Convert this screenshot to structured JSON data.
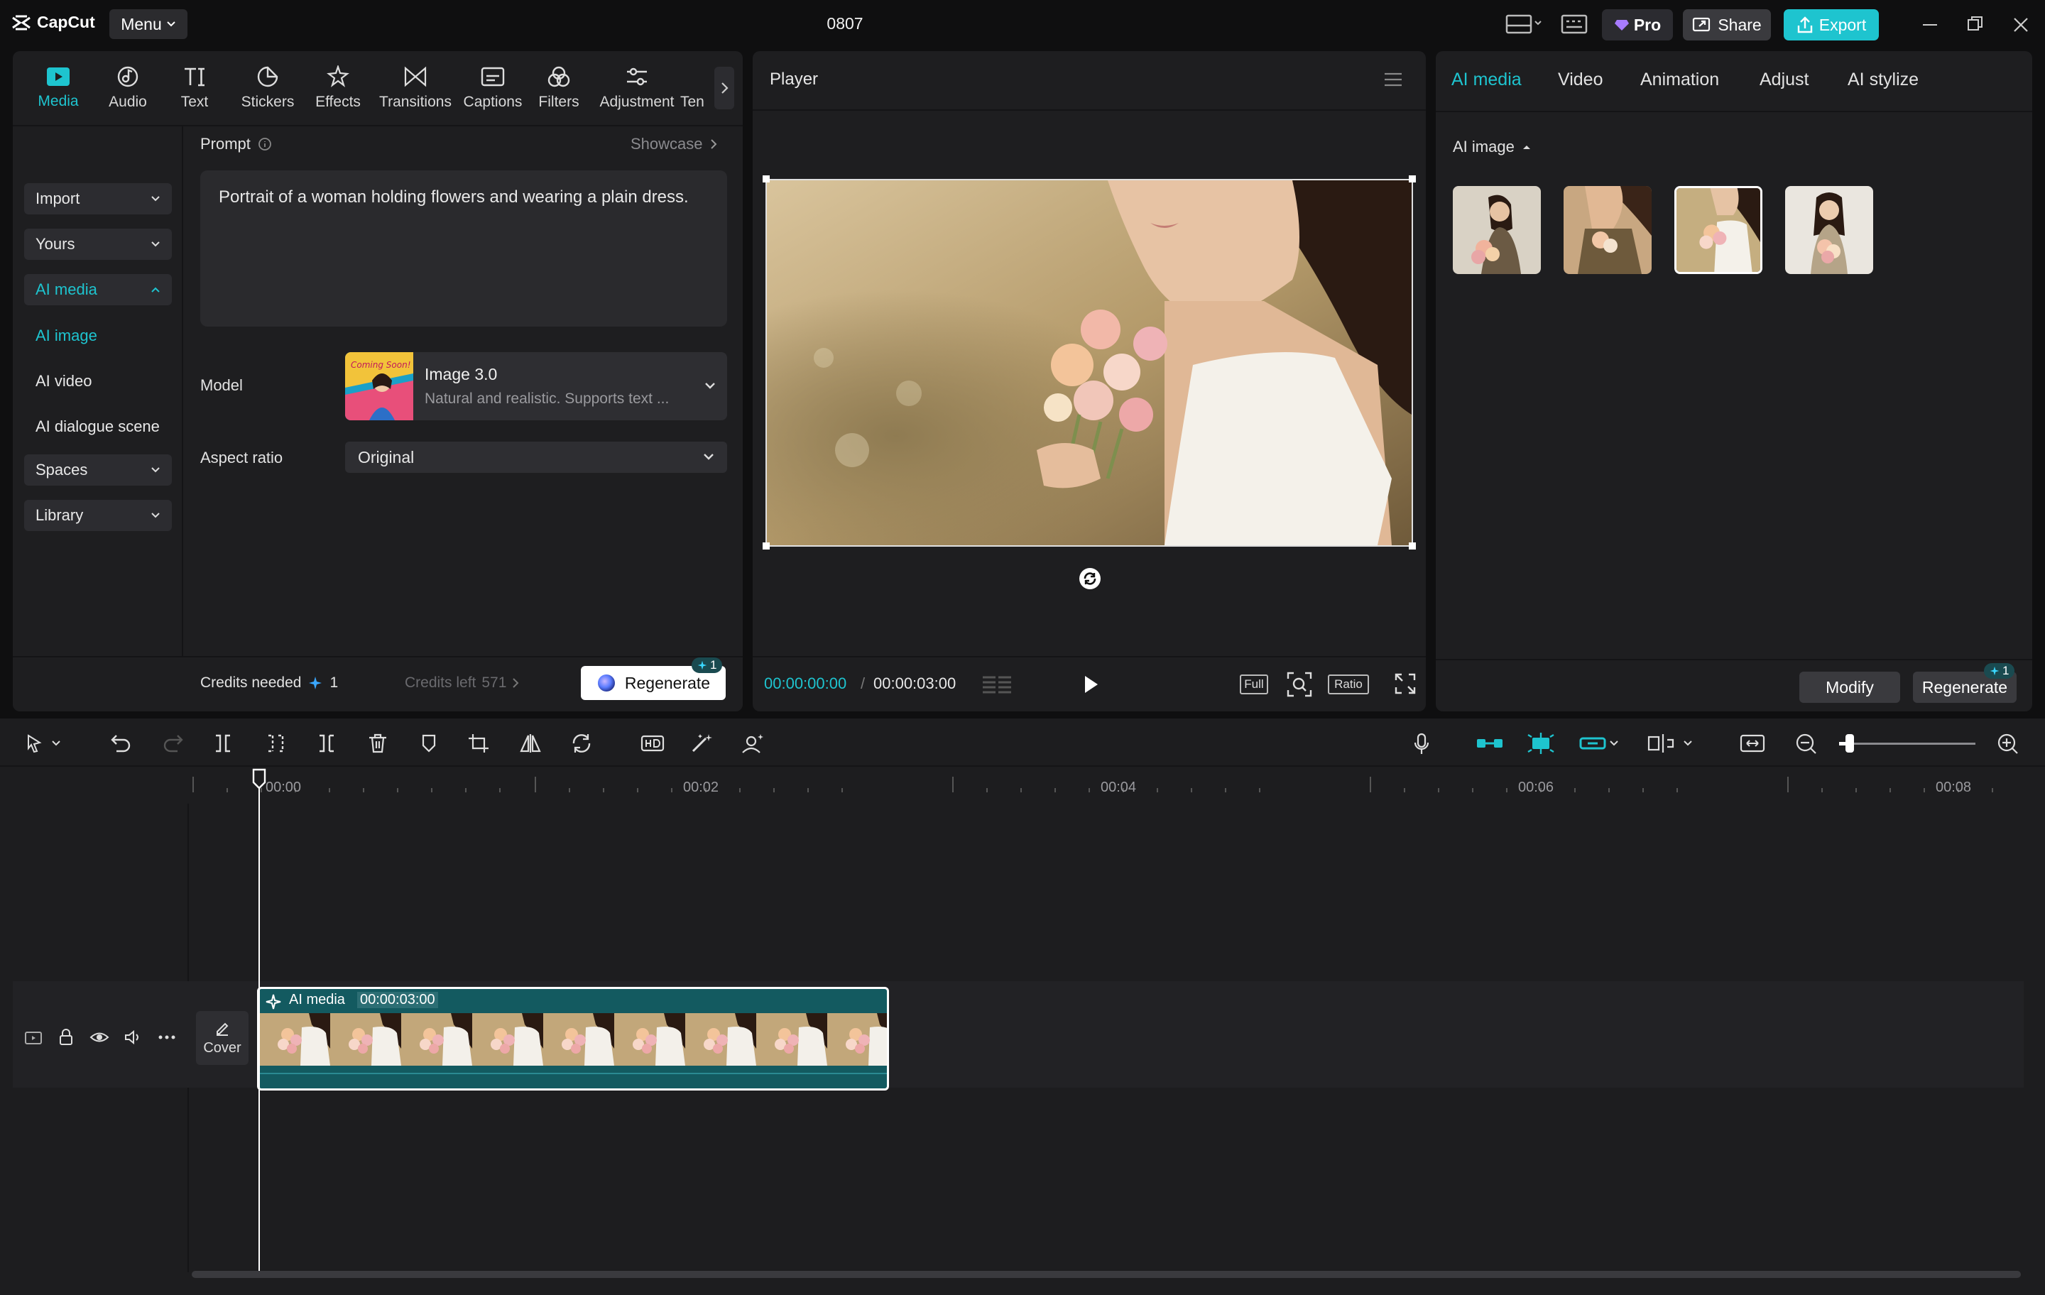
{
  "app": {
    "logo_text": "CapCut",
    "menu_label": "Menu",
    "project_title": "0807",
    "pro_label": "Pro",
    "share_label": "Share",
    "export_label": "Export",
    "accent_color": "#1ec4cf"
  },
  "toolbar": {
    "tabs": [
      {
        "label": "Media",
        "icon": "media-icon"
      },
      {
        "label": "Audio",
        "icon": "audio-icon"
      },
      {
        "label": "Text",
        "icon": "text-icon"
      },
      {
        "label": "Stickers",
        "icon": "stickers-icon"
      },
      {
        "label": "Effects",
        "icon": "effects-icon"
      },
      {
        "label": "Transitions",
        "icon": "transitions-icon"
      },
      {
        "label": "Captions",
        "icon": "captions-icon"
      },
      {
        "label": "Filters",
        "icon": "filters-icon"
      },
      {
        "label": "Adjustment",
        "icon": "adjustment-icon"
      },
      {
        "label": "Ten",
        "icon": "templates-icon"
      }
    ],
    "active_tab": "Media"
  },
  "sidebar": {
    "import_label": "Import",
    "yours_label": "Yours",
    "ai_media_label": "AI media",
    "ai_image_label": "AI image",
    "ai_video_label": "AI video",
    "ai_dialogue_label": "AI dialogue scene",
    "spaces_label": "Spaces",
    "library_label": "Library"
  },
  "generator": {
    "prompt_label": "Prompt",
    "showcase_label": "Showcase",
    "prompt_text": "Portrait of a woman holding flowers and wearing a plain dress.",
    "model_label": "Model",
    "model_name": "Image 3.0",
    "model_desc": "Natural and realistic. Supports text ...",
    "model_thumb_text": "Coming Soon!",
    "aspect_label": "Aspect ratio",
    "aspect_value": "Original",
    "credits_needed_label": "Credits needed",
    "credits_needed_value": "1",
    "credits_left_label": "Credits left",
    "credits_left_value": "571",
    "regenerate_label": "Regenerate",
    "regenerate_cost": "1"
  },
  "player": {
    "title": "Player",
    "current_time": "00:00:00:00",
    "separator": "/",
    "total_time": "00:00:03:00",
    "full_label": "Full",
    "ratio_label": "Ratio"
  },
  "right_panel": {
    "tabs": [
      "AI media",
      "Video",
      "Animation",
      "Adjust",
      "AI stylize"
    ],
    "section_label": "AI image",
    "modify_label": "Modify",
    "regenerate_label": "Regenerate",
    "regenerate_cost": "1"
  },
  "timeline": {
    "ruler_labels": [
      "00:00",
      "00:02",
      "00:04",
      "00:06",
      "00:08"
    ],
    "clip_label": "AI media",
    "clip_duration": "00:00:03:00",
    "cover_label": "Cover",
    "zoom_level": 0.08
  }
}
